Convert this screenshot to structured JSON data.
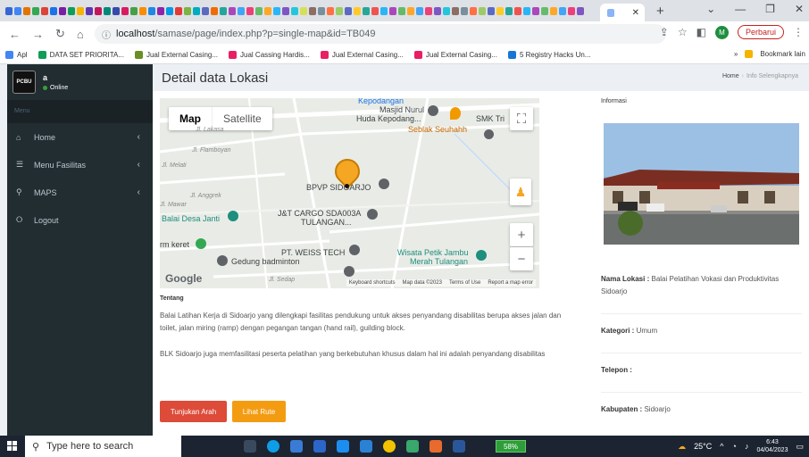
{
  "browser": {
    "tab_title": "",
    "url_host": "localhost",
    "url_path": "/samase/page/index.php?p=single-map&id=TB049",
    "update_label": "Perbarui",
    "profile_initial": "M"
  },
  "bookmarks": [
    {
      "label": "Apl",
      "color": "#4285f4"
    },
    {
      "label": "DATA SET PRIORITA...",
      "color": "#0f9d58"
    },
    {
      "label": "Jual External Casing...",
      "color": "#6b8e23"
    },
    {
      "label": "Jual Cassing Hardis...",
      "color": "#e91e63"
    },
    {
      "label": "Jual External Casing...",
      "color": "#e91e63"
    },
    {
      "label": "Jual External Casing...",
      "color": "#e91e63"
    },
    {
      "label": "5 Registry Hacks Un...",
      "color": "#1976d2"
    }
  ],
  "bookmarks_other": "Bookmark lain",
  "sidebar": {
    "logo_text": "PCBU",
    "user_name": "a",
    "user_status": "Online",
    "menu_header": "Menu",
    "items": [
      {
        "label": "Home",
        "icon": "home-icon"
      },
      {
        "label": "Menu Fasilitas",
        "icon": "list-icon"
      },
      {
        "label": "MAPS",
        "icon": "map-marker-icon"
      },
      {
        "label": "Logout",
        "icon": "logout-icon"
      }
    ]
  },
  "page": {
    "title": "Detail data Lokasi",
    "breadcrumb_home": "Home",
    "breadcrumb_current": "Info Selengkapnya"
  },
  "map": {
    "toggle_map": "Map",
    "toggle_satellite": "Satellite",
    "labels": {
      "kepodangan": "Kepodangan",
      "masjid": "Masjid Nurul",
      "masjid2": "Huda Kepodang...",
      "smk": "SMK Tri",
      "seblak": "Seblak Seuhahh",
      "lakasa": "Jl. Lakasa",
      "flamboyan": "Jl. Flamboyan",
      "melati": "Jl. Melati",
      "bpvp": "BPVP SIDOARJO",
      "anggrek": "Jl. Anggrek",
      "mawar": "Jl. Mawar",
      "balai_desa": "Balai Desa Janti",
      "jnt": "J&T CARGO SDA003A",
      "jnt2": "TULANGAN...",
      "market": "rm keret",
      "weiss": "PT. WEISS TECH",
      "wisata": "Wisata Petik Jambu",
      "wisata2": "Merah Tulangan",
      "badminton": "Gedung badminton",
      "sedap": "Jl. Sedap"
    },
    "google": "Google",
    "footer_shortcuts": "Keyboard shortcuts",
    "footer_data": "Map data ©2023",
    "footer_terms": "Terms of Use",
    "footer_report": "Report a map error"
  },
  "description": {
    "heading": "Tentang",
    "para1": "Balai Latihan Kerja di Sidoarjo yang dilengkapi fasilitas pendukung untuk akses penyandang disabilitas berupa akses jalan dan toilet, jalan miring (ramp) dengan pegangan tangan (hand rail), guilding block.",
    "para2": "BLK Sidoarjo juga memfasilitasi peserta pelatihan yang berkebutuhan khusus dalam hal ini adalah penyandang disabilitas"
  },
  "buttons": {
    "directions": "Tunjukan Arah",
    "view_route": "Lihat Rute"
  },
  "info": {
    "title": "Informasi",
    "name_label": "Nama Lokasi :",
    "name_value": "Balai Pelatihan Vokasi dan Produktivitas Sidoarjo",
    "category_label": "Kategori :",
    "category_value": "Umum",
    "phone_label": "Telepon :",
    "phone_value": "",
    "district_label": "Kabupaten :",
    "district_value": "Sidoarjo"
  },
  "taskbar": {
    "search_placeholder": "Type here to search",
    "battery": "58%",
    "temperature": "25°C",
    "time": "6:43",
    "date": "04/04/2023"
  },
  "colors": {
    "sidebar_bg": "#222d32",
    "btn_red": "#dd4b39",
    "btn_yellow": "#f39c12",
    "marker": "#f5a623"
  }
}
